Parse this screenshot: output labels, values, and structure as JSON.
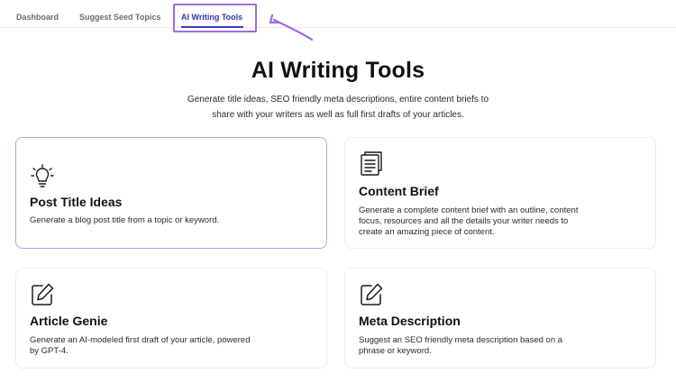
{
  "tabs": [
    {
      "label": "Dashboard",
      "active": false
    },
    {
      "label": "Suggest Seed Topics",
      "active": false
    },
    {
      "label": "AI Writing Tools",
      "active": true
    }
  ],
  "header": {
    "title": "AI Writing Tools",
    "subtitle_line1": "Generate title ideas, SEO friendly meta descriptions, entire content briefs to",
    "subtitle_line2": "share with your writers as well as full first drafts of your articles."
  },
  "cards": [
    {
      "icon": "lightbulb-icon",
      "title": "Post Title Ideas",
      "desc_lines": [
        "Generate a blog post title from a topic or keyword."
      ],
      "selected": true
    },
    {
      "icon": "document-icon",
      "title": "Content Brief",
      "desc_lines": [
        "Generate a complete content brief with an outline, content",
        "focus, resources and all the details your writer needs to",
        "create an amazing piece of content."
      ],
      "selected": false
    },
    {
      "icon": "edit-icon",
      "title": "Article Genie",
      "desc_lines": [
        "Generate an AI-modeled first draft of your article, powered",
        "by GPT-4."
      ],
      "selected": false
    },
    {
      "icon": "edit-icon",
      "title": "Meta Description",
      "desc_lines": [
        "Suggest an SEO friendly meta description based on a",
        "phrase or keyword."
      ],
      "selected": false
    }
  ],
  "colors": {
    "accent": "#3b3fbf",
    "highlight": "#9b6ce0",
    "selected_border": "#a7a9e6"
  }
}
